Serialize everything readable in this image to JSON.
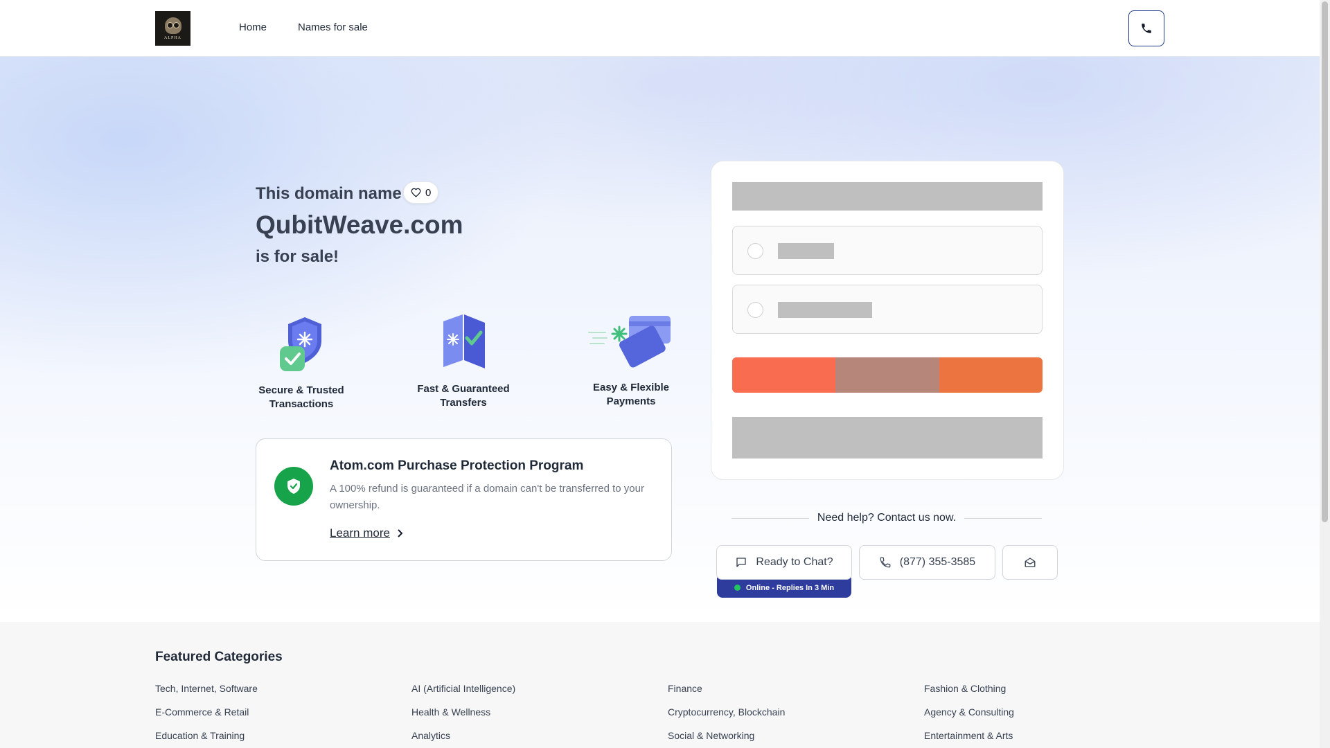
{
  "header": {
    "logo_text": "ALPHA",
    "nav": {
      "home": "Home",
      "names_for_sale": "Names for sale"
    },
    "phone_icon": "phone-icon"
  },
  "hero": {
    "title_prefix": "This domain name",
    "likes": "0",
    "domain": "QubitWeave.com",
    "title_suffix": "is for sale!",
    "features": [
      {
        "label_line1": "Secure & Trusted",
        "label_line2": "Transactions",
        "icon": "shield-check-icon"
      },
      {
        "label_line1": "Fast & Guaranteed",
        "label_line2": "Transfers",
        "icon": "transfer-icon"
      },
      {
        "label_line1": "Easy & Flexible",
        "label_line2": "Payments",
        "icon": "card-icon"
      }
    ],
    "protection": {
      "title": "Atom.com Purchase Protection Program",
      "description": "A 100% refund is guaranteed if a domain can't be transferred to your ownership.",
      "link": "Learn more"
    }
  },
  "contact": {
    "help_text": "Need help? Contact us now.",
    "chat_label": "Ready to Chat?",
    "phone": "(877) 355-3585",
    "online_status": "Online - Replies In 3 Min"
  },
  "categories": {
    "title": "Featured Categories",
    "columns": [
      [
        "Tech, Internet, Software",
        "E-Commerce & Retail",
        "Education & Training"
      ],
      [
        "AI (Artificial Intelligence)",
        "Health & Wellness",
        "Analytics"
      ],
      [
        "Finance",
        "Cryptocurrency, Blockchain",
        "Social & Networking"
      ],
      [
        "Fashion & Clothing",
        "Agency & Consulting",
        "Entertainment & Arts"
      ]
    ]
  },
  "colors": {
    "brand_blue": "#1e3a8a",
    "protect_green": "#16a34a",
    "cta_orange": "#f96c4f",
    "online_bar": "#2e3c9e"
  }
}
